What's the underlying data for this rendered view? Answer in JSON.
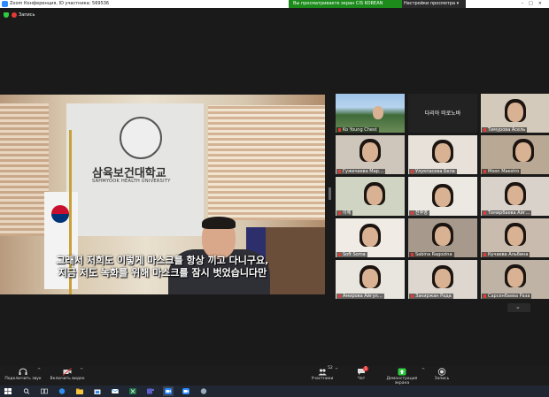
{
  "window": {
    "title": "Zoom Конференция, ID участника: 569536"
  },
  "share_bar": {
    "message": "Вы просматриваете экран CIS KOREAN STUDIES",
    "options_label": "Настройки просмотра"
  },
  "recording": {
    "label": "Запись"
  },
  "main_video": {
    "university_name_kr": "삼육보건대학교",
    "university_name_en": "SAHMYOOK HEALTH UNIVERSITY",
    "subtitle_line1": "그래서 저희도 이렇게 마스크를 항상 끼고 다니구요,",
    "subtitle_line2": "지금 저도 녹화를 위해 마스크를 잠시 벗었습니다만"
  },
  "gallery": {
    "tiles": [
      {
        "name": "Ko Young Chest",
        "muted": true
      },
      {
        "name": "",
        "center_text": "다리아 미로노바",
        "muted": false
      },
      {
        "name": "Тимурова Асель",
        "muted": true
      },
      {
        "name": "Гужечаева Мар…",
        "muted": true
      },
      {
        "name": "Улукпасева Бела",
        "muted": true
      },
      {
        "name": "Moon Maestro",
        "muted": true
      },
      {
        "name": "이예",
        "muted": true
      },
      {
        "name": "전주영",
        "muted": true
      },
      {
        "name": "Темирбаева Айг…",
        "muted": true
      },
      {
        "name": "Soft Soma",
        "muted": true
      },
      {
        "name": "Sabina Ragozina",
        "muted": true
      },
      {
        "name": "Кучаева Альбина",
        "muted": true
      },
      {
        "name": "Амирова Айгул…",
        "muted": true
      },
      {
        "name": "Закиржан Рада",
        "muted": true
      },
      {
        "name": "Сарсенбаева Раза",
        "muted": true
      }
    ]
  },
  "toolbar": {
    "audio_label": "Подключить звук",
    "video_label": "Включить видео",
    "participants_label": "Участники",
    "participants_count": "52",
    "chat_label": "Чат",
    "chat_badge": "1",
    "share_label": "Демонстрация экрана",
    "record_label": "Запись"
  },
  "colors": {
    "share_green": "#1c8b1c",
    "zoom_blue": "#2d8cff",
    "muted_red": "#e53935"
  }
}
